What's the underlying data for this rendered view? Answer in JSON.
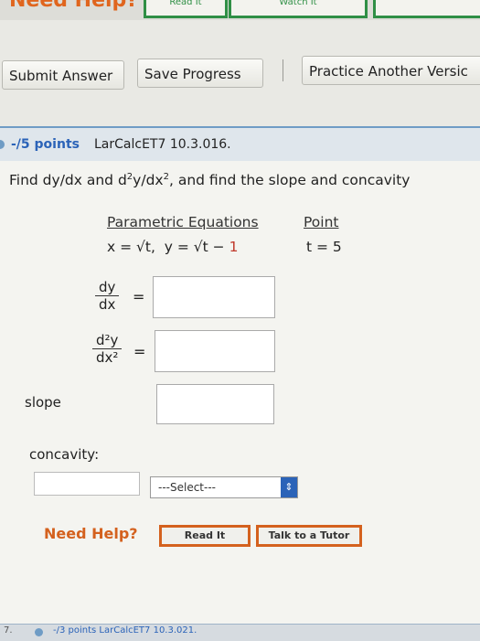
{
  "top": {
    "help_text": "Need Help?",
    "btn1": "Read It",
    "btn2": "Watch It"
  },
  "toolbar": {
    "submit": "Submit Answer",
    "save": "Save Progress",
    "practice": "Practice Another Versic"
  },
  "question": {
    "points": "-/5 points",
    "id": "LarCalcET7 10.3.016.",
    "prompt_a": "Find dy/dx and d",
    "prompt_sup1": "2",
    "prompt_b": "y/dx",
    "prompt_sup2": "2",
    "prompt_c": ", and find the slope and concavity",
    "col_equations": "Parametric Equations",
    "col_point": "Point",
    "eq_x": "x = √t,",
    "eq_y_prefix": "y = √t − ",
    "eq_y_const": "1",
    "point": "t = 5"
  },
  "answers": {
    "dydx_num": "dy",
    "dydx_den": "dx",
    "d2y_num": "d²y",
    "d2y_den": "dx²",
    "equals": "=",
    "slope_label": "slope",
    "concavity_label": "concavity:",
    "select_value": "---Select---"
  },
  "help": {
    "label": "Need Help?",
    "read_it": "Read It",
    "talk": "Talk to a Tutor"
  },
  "footer": {
    "num": "7.",
    "text": "-/3 points LarCalcET7 10.3.021."
  },
  "colors": {
    "accent_blue": "#2b63b8",
    "help_orange": "#d4611e",
    "header_border": "#6f9cc5"
  }
}
